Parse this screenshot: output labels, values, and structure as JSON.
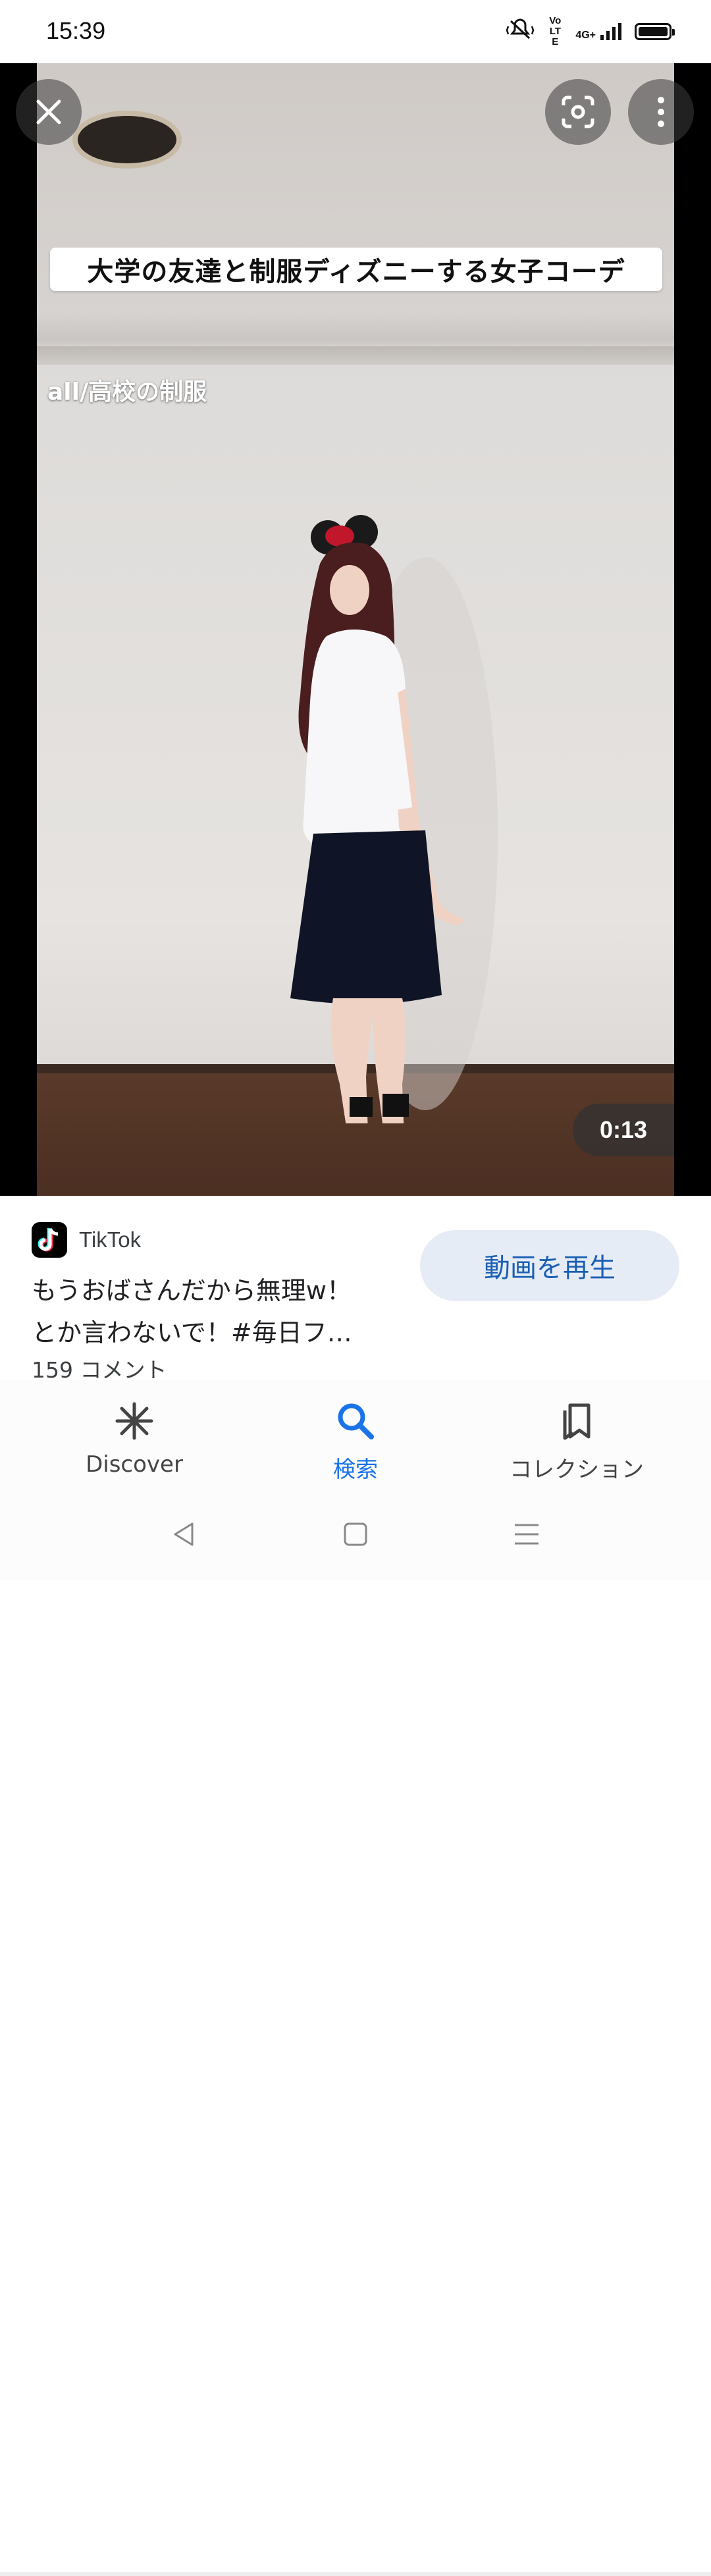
{
  "status_bar": {
    "time": "15:39",
    "volte_label": "Vo LTE",
    "network_label": "4G+",
    "icons": [
      "mute-vibrate-icon",
      "volte-icon",
      "signal-icon",
      "battery-icon"
    ]
  },
  "viewer": {
    "caption_main": "大学の友達と制服ディズニーする女子コーデ",
    "caption_sub": "all/高校の制服",
    "duration": "0:13",
    "buttons": [
      "close-icon",
      "lens-icon",
      "more-vert-icon"
    ]
  },
  "result": {
    "source": "TikTok",
    "title_line1": "もうおばさんだから無理w！",
    "title_line2": "とか言わないで！#毎日フ…",
    "comments": "159 コメント",
    "play_button": "動画を再生"
  },
  "bottom_nav": {
    "items": [
      {
        "label": "Discover",
        "icon": "asterisk-icon",
        "active": false
      },
      {
        "label": "検索",
        "icon": "search-icon",
        "active": true
      },
      {
        "label": "コレクション",
        "icon": "collections-bookmark-icon",
        "active": false
      }
    ]
  },
  "colors": {
    "accent": "#1a73e8",
    "play_button_bg": "#e6ecf6",
    "play_button_text": "#1a5fb4"
  }
}
